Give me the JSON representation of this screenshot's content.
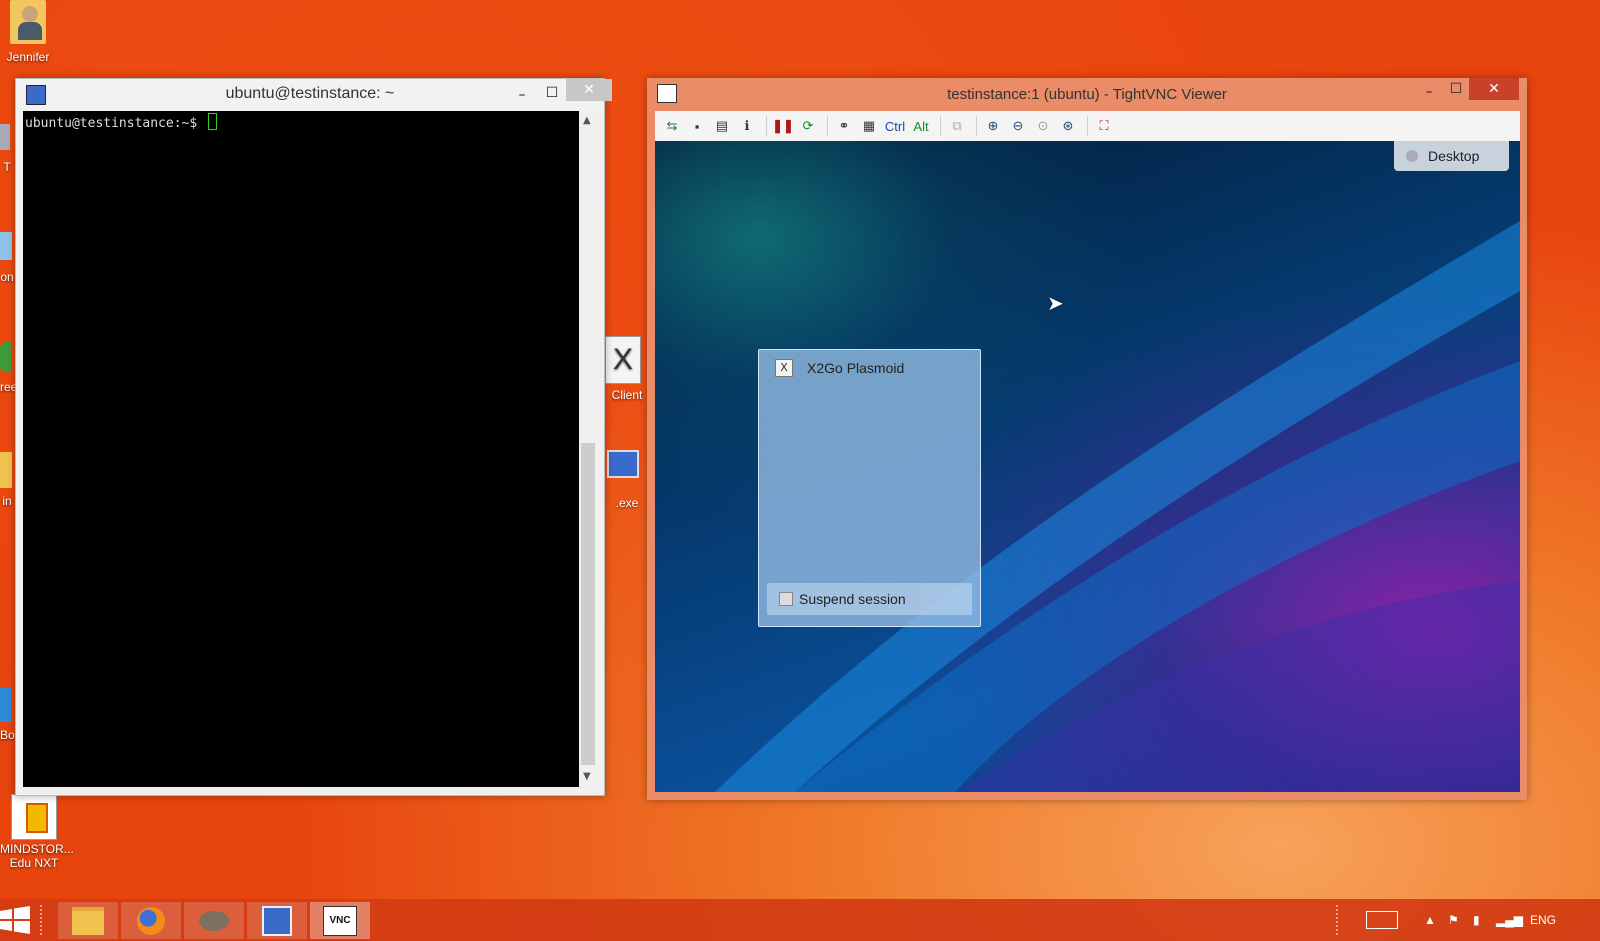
{
  "desktop": {
    "icons": [
      {
        "label": "Jennifer"
      },
      {
        "label": "T"
      },
      {
        "label": "on"
      },
      {
        "label": "ree"
      },
      {
        "label": "in"
      },
      {
        "label": "Bo"
      },
      {
        "label": "MINDSTOR..."
      },
      {
        "label": "Edu NXT"
      },
      {
        "label": "Client"
      },
      {
        "label": ".exe"
      }
    ]
  },
  "terminal": {
    "title": "ubuntu@testinstance: ~",
    "prompt": "ubuntu@testinstance:~$ ",
    "controls": {
      "minimize": "–",
      "maximize": "☐",
      "close": "✕"
    }
  },
  "vnc": {
    "title": "testinstance:1 (ubuntu) - TightVNC Viewer",
    "toolbar": {
      "ctrl": "Ctrl",
      "alt": "Alt"
    },
    "controls": {
      "minimize": "–",
      "maximize": "☐",
      "close": "✕"
    },
    "remote": {
      "desktop_button": "Desktop",
      "panel_title": "X2Go Plasmoid",
      "suspend_label": "Suspend session"
    }
  },
  "taskbar": {
    "language": "ENG"
  }
}
